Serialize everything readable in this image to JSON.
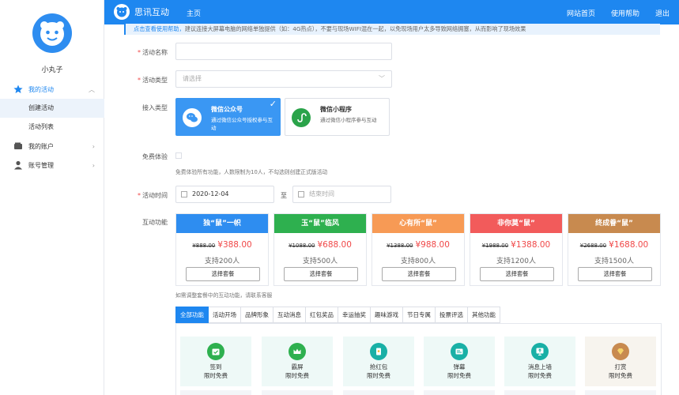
{
  "sidebar": {
    "username": "小丸子",
    "items": [
      {
        "label": "我的活动",
        "icon": "star-icon"
      },
      {
        "label": "创建活动"
      },
      {
        "label": "活动列表"
      },
      {
        "label": "我的账户",
        "icon": "wallet-icon"
      },
      {
        "label": "账号管理",
        "icon": "user-icon"
      }
    ]
  },
  "topbar": {
    "brand": "思讯互动",
    "home": "主页",
    "links": [
      "网站首页",
      "使用帮助",
      "退出"
    ]
  },
  "notice": {
    "link": "点击查看使用帮助，",
    "text": "建议连接大屏幕电脑的网络单独提供（如：4G热点），不要与现场WIFI混在一起，以免现场用户太多导致网络拥塞，从而影响了现场效果"
  },
  "form": {
    "name_label": "活动名称",
    "type_label": "活动类型",
    "type_placeholder": "请选择",
    "access_label": "接入类型",
    "access_options": [
      {
        "title": "微信公众号",
        "desc": "通过微信公众号授权参与互动"
      },
      {
        "title": "微信小程序",
        "desc": "通过微信小程序参与互动"
      }
    ],
    "trial_label": "免费体验",
    "trial_hint": "免费体验所有功能，人数限制为10人，不勾选则创建正式版活动",
    "time_label": "活动时间",
    "start_date": "2020-12-04",
    "to": "至",
    "end_placeholder": "结束时间",
    "feature_label": "互动功能",
    "feature_hint": "如需调整套餐中的互动功能，请联系客服"
  },
  "packages": [
    {
      "name": "独“鼠”一帜",
      "old": "¥888.00",
      "new": "¥388.00",
      "users": "支持200人",
      "button": "选择套餐",
      "color": "#2e8df0"
    },
    {
      "name": "玉“鼠”临风",
      "old": "¥1088.00",
      "new": "¥688.00",
      "users": "支持500人",
      "button": "选择套餐",
      "color": "#2eb04f"
    },
    {
      "name": "心有所“鼠”",
      "old": "¥1388.00",
      "new": "¥988.00",
      "users": "支持800人",
      "button": "选择套餐",
      "color": "#f79a55"
    },
    {
      "name": "非你莫“鼠”",
      "old": "¥1988.00",
      "new": "¥1388.00",
      "users": "支持1200人",
      "button": "选择套餐",
      "color": "#f25b5b"
    },
    {
      "name": "终成眷“鼠”",
      "old": "¥2688.00",
      "new": "¥1688.00",
      "users": "支持1500人",
      "button": "选择套餐",
      "color": "#c88a4f"
    }
  ],
  "tabs": [
    "全部功能",
    "活动开场",
    "品牌形象",
    "互动消息",
    "红包奖品",
    "幸运抽奖",
    "趣味游戏",
    "节日专属",
    "投票评选",
    "其他功能"
  ],
  "features": [
    {
      "name": "签到",
      "sub": "限时免费",
      "icon": "calendar-icon",
      "color": "#2eb04f"
    },
    {
      "name": "霸屏",
      "sub": "限时免费",
      "icon": "crown-icon",
      "color": "#2eb04f"
    },
    {
      "name": "抢红包",
      "sub": "限时免费",
      "icon": "red-packet-icon",
      "color": "#19b0a6"
    },
    {
      "name": "弹幕",
      "sub": "限时免费",
      "icon": "barrage-icon",
      "color": "#19b0a6"
    },
    {
      "name": "消息上墙",
      "sub": "限时免费",
      "icon": "message-wall-icon",
      "color": "#19b0a6"
    },
    {
      "name": "打赏",
      "sub": "限时免费",
      "icon": "reward-icon",
      "color": "#c88a4f"
    }
  ]
}
